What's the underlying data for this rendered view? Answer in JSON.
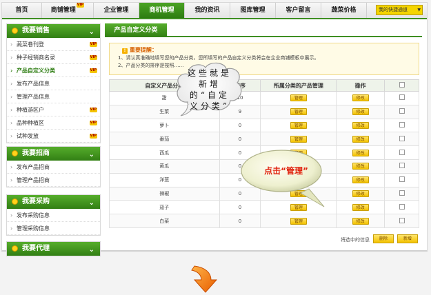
{
  "nav": {
    "items": [
      {
        "label": "首页",
        "w": 58
      },
      {
        "label": "商铺管理",
        "vip": "VIP",
        "w": 75
      },
      {
        "label": "企业管理",
        "w": 66
      },
      {
        "label": "商机管理",
        "w": 66,
        "active": true
      },
      {
        "label": "我的资讯",
        "w": 66
      },
      {
        "label": "图库管理",
        "w": 66
      },
      {
        "label": "客户留言",
        "w": 66
      },
      {
        "label": "蔬菜价格",
        "w": 66
      }
    ],
    "quick_label": "我的快捷通道"
  },
  "vip_badge": "VIP",
  "sidebar": [
    {
      "title": "我要销售",
      "items": [
        {
          "label": "蔬菜卷刊登",
          "vip": true
        },
        {
          "label": "种子经销商名录",
          "vip": true
        },
        {
          "label": "产品自定义分类",
          "vip": true,
          "active": true
        },
        {
          "label": "发布产品信息"
        },
        {
          "label": "管理产品信息"
        },
        {
          "label": "种植游区户",
          "vip": true
        },
        {
          "label": "品种种植区",
          "vip": true
        },
        {
          "label": "试种发放",
          "vip": true
        }
      ]
    },
    {
      "title": "我要招商",
      "items": [
        {
          "label": "发布产品招商"
        },
        {
          "label": "管理产品招商"
        }
      ]
    },
    {
      "title": "我要采购",
      "items": [
        {
          "label": "发布采购信息"
        },
        {
          "label": "管理采购信息"
        }
      ]
    },
    {
      "title": "我要代理",
      "items": []
    }
  ],
  "content": {
    "tab": "产品自定义分类",
    "notice_title": "重要提醒：",
    "notice_lines": [
      "1、请认真准确地填写您的产品分类，您所填写的产品自定义分类将会在企业商铺模板中展示。",
      "2、产品分类的排序是按照……"
    ]
  },
  "table": {
    "headers": [
      "自定义产品分类",
      "排序",
      "所属分类的产品管理",
      "操作",
      ""
    ],
    "rows": [
      {
        "name": "甜",
        "order": "10"
      },
      {
        "name": "生菜",
        "order": "9"
      },
      {
        "name": "萝卜",
        "order": "0"
      },
      {
        "name": "番茄",
        "order": "0"
      },
      {
        "name": "西瓜",
        "order": "0"
      },
      {
        "name": "黄瓜",
        "order": "0"
      },
      {
        "name": "洋葱",
        "order": "0"
      },
      {
        "name": "辣椒",
        "order": "0"
      },
      {
        "name": "茄子",
        "order": "0"
      },
      {
        "name": "白菜",
        "order": "0"
      }
    ],
    "manage_label": "管理",
    "edit_label": "修改"
  },
  "footer": {
    "label": "将选中的信息",
    "delete": "删除",
    "add": "新增"
  },
  "callout1": "这些就是新增的“自定义分类”",
  "callout2": "点击“管理”"
}
